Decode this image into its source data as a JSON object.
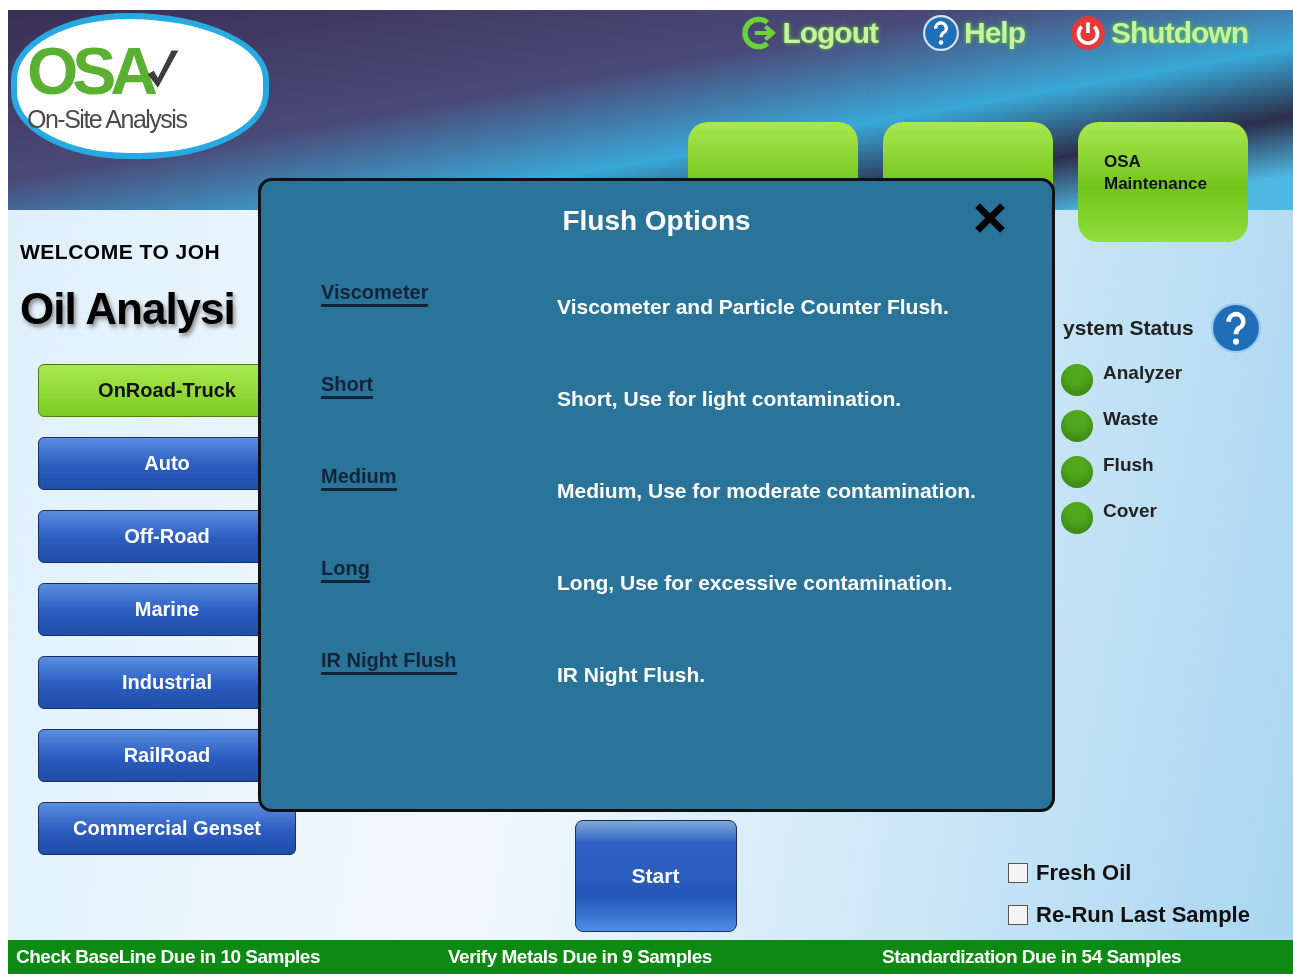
{
  "logo": {
    "mark": "OSA",
    "tagline": "On-Site Analysis"
  },
  "top_links": [
    {
      "kind": "logout",
      "label": "Logout"
    },
    {
      "kind": "help",
      "label": "Help"
    },
    {
      "kind": "shutdown",
      "label": "Shutdown"
    }
  ],
  "tabs": [
    {
      "kind": "covered"
    },
    {
      "kind": "covered"
    },
    {
      "kind": "labeled",
      "label": "OSA Maintenance"
    }
  ],
  "welcome": "WELCOME TO JOH",
  "page_title": "Oil Analysi",
  "categories": [
    {
      "label": "OnRoad-Truck",
      "selected": true
    },
    {
      "label": "Auto",
      "selected": false
    },
    {
      "label": "Off-Road",
      "selected": false
    },
    {
      "label": "Marine",
      "selected": false
    },
    {
      "label": "Industrial",
      "selected": false
    },
    {
      "label": "RailRoad",
      "selected": false
    },
    {
      "label": "Commercial Genset",
      "selected": false
    }
  ],
  "start_button": "Start",
  "system_status": {
    "title": "ystem Status",
    "items": [
      {
        "label": "Analyzer",
        "color": "#4fa81c"
      },
      {
        "label": "Waste",
        "color": "#4fa81c"
      },
      {
        "label": "Flush",
        "color": "#4fa81c"
      },
      {
        "label": "Cover",
        "color": "#4fa81c"
      }
    ]
  },
  "options": [
    {
      "label": "Fresh Oil",
      "checked": false
    },
    {
      "label": "Re-Run Last Sample",
      "checked": false
    }
  ],
  "status_bar": [
    "Check BaseLine Due in 10 Samples",
    "Verify Metals Due in 9 Samples",
    "Standardization Due in 54 Samples"
  ],
  "dialog": {
    "title": "Flush Options",
    "rows": [
      {
        "option": "Viscometer",
        "description": "Viscometer and Particle Counter Flush."
      },
      {
        "option": "Short",
        "description": "Short, Use for light contamination."
      },
      {
        "option": "Medium",
        "description": "Medium, Use for moderate contamination."
      },
      {
        "option": "Long",
        "description": "Long, Use for excessive contamination."
      },
      {
        "option": "IR Night Flush",
        "description": "IR Night Flush."
      }
    ]
  }
}
